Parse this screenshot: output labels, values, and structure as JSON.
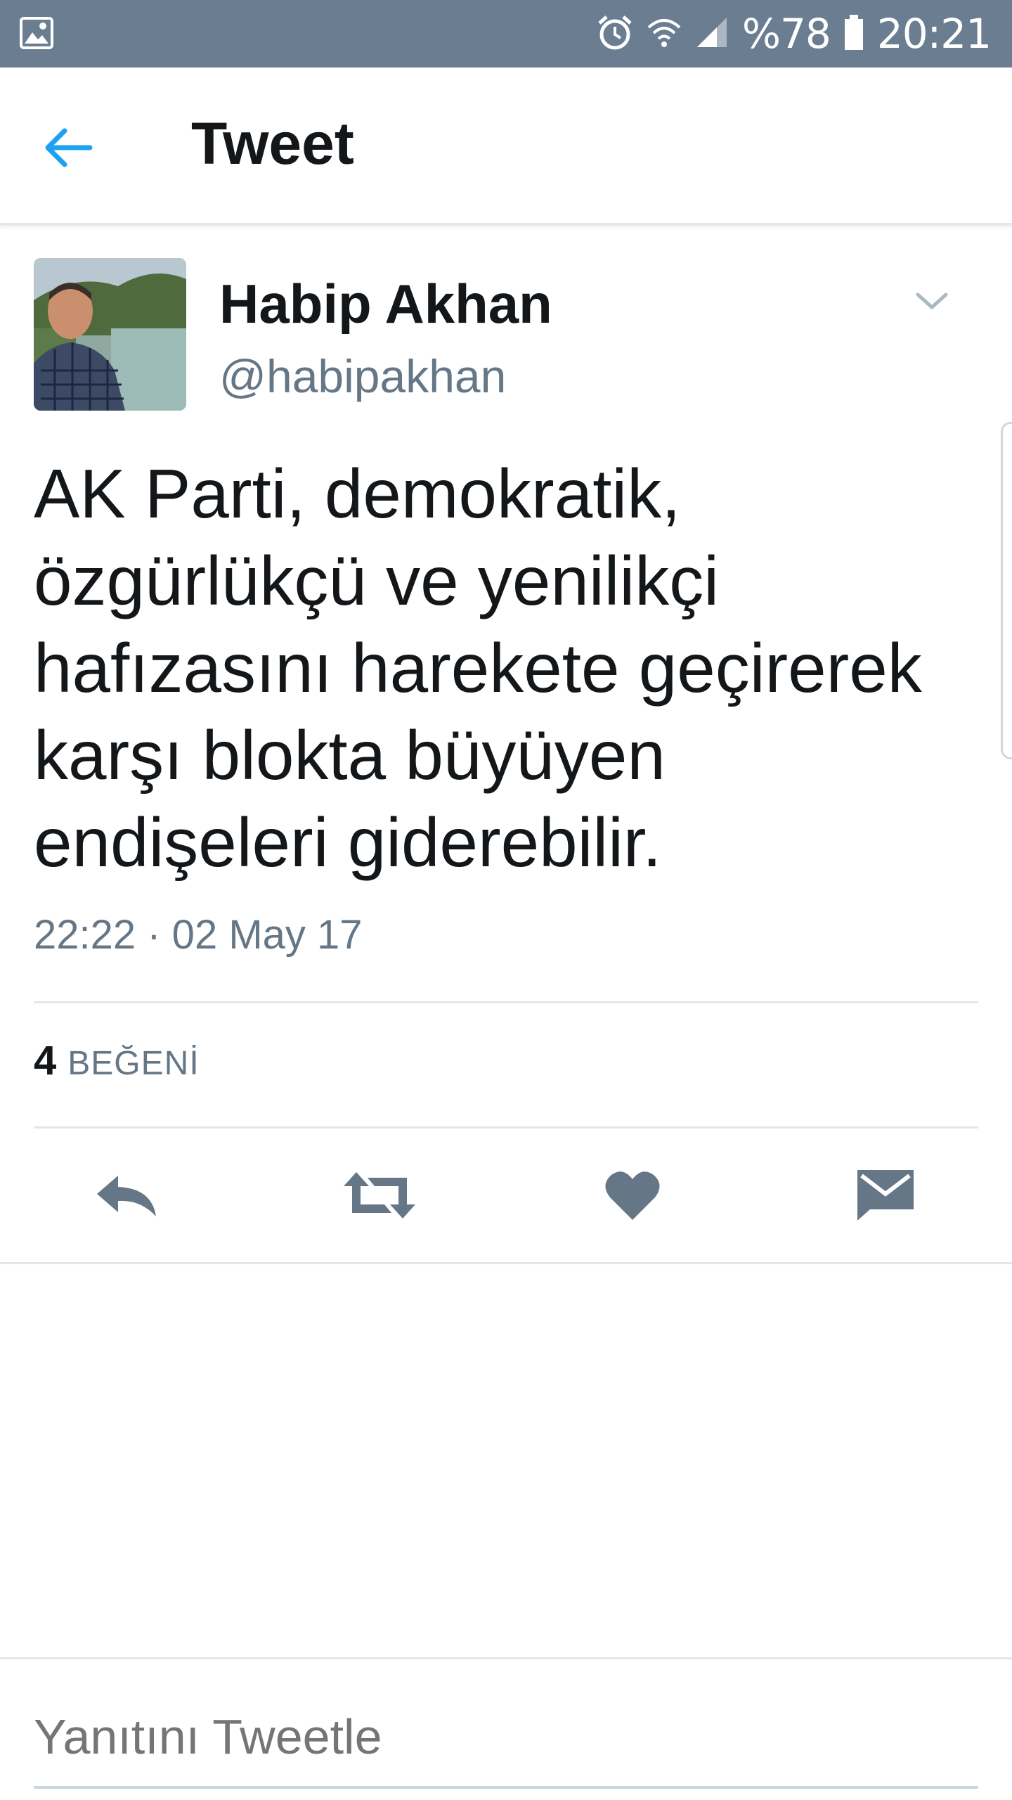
{
  "status_bar": {
    "left_icon": "gallery-icon",
    "icons": [
      "alarm-icon",
      "wifi-icon",
      "signal-icon",
      "battery-icon"
    ],
    "battery_text": "%78",
    "clock": "20:21"
  },
  "header": {
    "back_icon": "back-arrow-icon",
    "title": "Tweet",
    "accent_color": "#1da1f2"
  },
  "tweet": {
    "author_name": "Habip Akhan",
    "author_handle": "@habipakhan",
    "menu_icon": "chevron-down-icon",
    "text": "AK Parti, demokratik, özgürlükçü ve yenilikçi hafızasını harekete geçirerek karşı blokta büyüyen endişeleri giderebilir.",
    "timestamp": "22:22 · 02 May 17",
    "likes_count": "4",
    "likes_label": "BEĞENİ"
  },
  "actions": [
    {
      "name": "reply-button",
      "icon": "reply-icon"
    },
    {
      "name": "retweet-button",
      "icon": "retweet-icon"
    },
    {
      "name": "like-button",
      "icon": "heart-icon"
    },
    {
      "name": "direct-message-button",
      "icon": "envelope-icon"
    }
  ],
  "reply": {
    "placeholder": "Yanıtını Tweetle"
  },
  "colors": {
    "status_bar": "#6a7d91",
    "icon_gray": "#657786",
    "text_dark": "#14171a"
  }
}
